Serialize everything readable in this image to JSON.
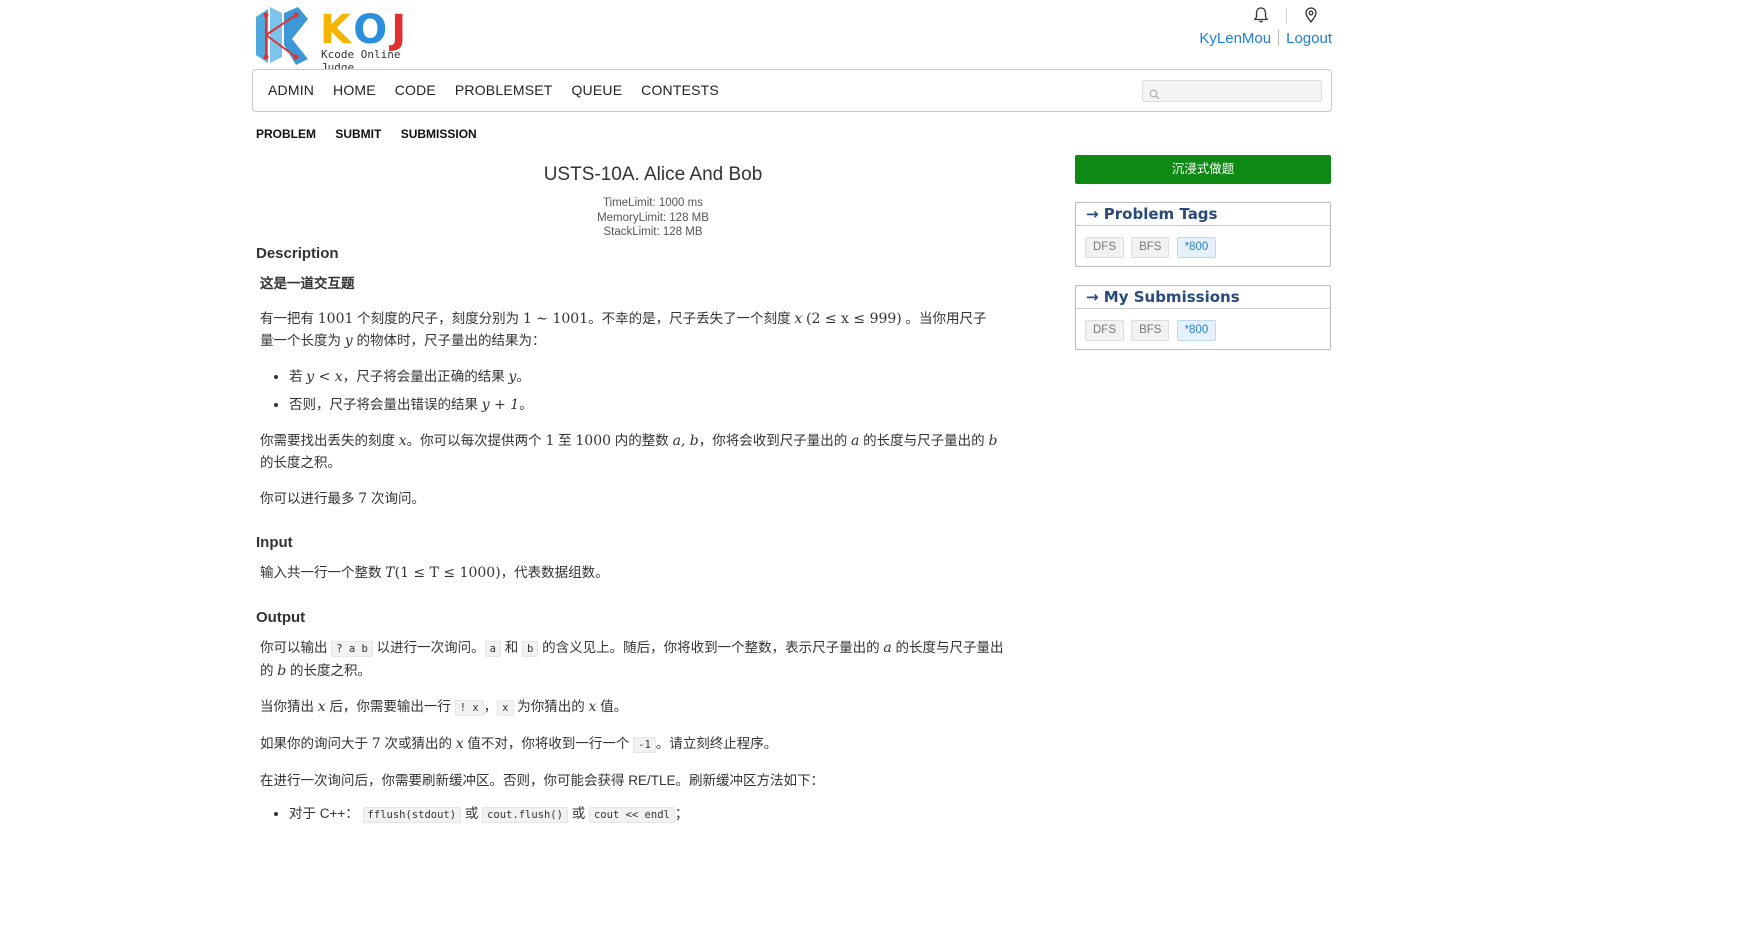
{
  "header": {
    "logo_text": "KOJ",
    "logo_subtitle": "Kcode Online Judge",
    "username": "KyLenMou",
    "logout": "Logout"
  },
  "nav": {
    "items": [
      "ADMIN",
      "HOME",
      "CODE",
      "PROBLEMSET",
      "QUEUE",
      "CONTESTS"
    ],
    "search_placeholder": ""
  },
  "subnav": {
    "items": [
      "PROBLEM",
      "SUBMIT",
      "SUBMISSION"
    ]
  },
  "problem": {
    "title": "USTS-10A. Alice And Bob",
    "time_limit": "TimeLimit: 1000 ms",
    "memory_limit": "MemoryLimit: 128 MB",
    "stack_limit": "StackLimit: 128 MB",
    "description_head": "Description",
    "interactive_note": "这是一道交互题",
    "desc_p1_a": "有一把有",
    "desc_p1_n1": "1001",
    "desc_p1_b": "个刻度的尺子，刻度分别为",
    "desc_p1_range": "1 ∼ 1001",
    "desc_p1_c": "。不幸的是，尺子丢失了一个刻度",
    "desc_p1_x": "x",
    "desc_p1_cond": "(2 ≤ x ≤ 999)",
    "desc_p1_d": "。当你用尺子",
    "desc_p1_e": "量一个长度为",
    "desc_p1_y": "y",
    "desc_p1_f": "的物体时，尺子量出的结果为：",
    "bullet1_a": "若",
    "bullet1_m": "y < x",
    "bullet1_b": "，尺子将会量出正确的结果",
    "bullet1_y": "y",
    "bullet1_c": "。",
    "bullet2_a": "否则，尺子将会量出错误的结果",
    "bullet2_m": "y + 1",
    "bullet2_c": "。",
    "desc_p2_a": "你需要找出丢失的刻度",
    "desc_p2_x": "x",
    "desc_p2_b": "。你可以每次提供两个",
    "desc_p2_n1": "1",
    "desc_p2_c": "至",
    "desc_p2_n2": "1000",
    "desc_p2_d": "内的整数",
    "desc_p2_ab": "a, b",
    "desc_p2_e": "，你将会收到尺子量出的",
    "desc_p2_a2": "a",
    "desc_p2_f": "的长度与尺子量出的",
    "desc_p2_b2": "b",
    "desc_p2_g": "的长度之积。",
    "desc_p3_a": "你可以进行最多",
    "desc_p3_n": "7",
    "desc_p3_b": "次询问。",
    "input_head": "Input",
    "input_a": "输入共一行一个整数",
    "input_T": "T",
    "input_cond": "(1 ≤ T ≤ 1000)",
    "input_b": "，代表数据组数。",
    "output_head": "Output",
    "out_p1_a": "你可以输出",
    "out_p1_code1": "? a b",
    "out_p1_b": "以进行一次询问。",
    "out_p1_code2": "a",
    "out_p1_c": "和",
    "out_p1_code3": "b",
    "out_p1_d": "的含义见上。随后，你将收到一个整数，表示尺子量出的",
    "out_p1_a2": "a",
    "out_p1_e": "的长度与尺子量出",
    "out_p1_f": "的",
    "out_p1_b2": "b",
    "out_p1_g": "的长度之积。",
    "out_p2_a": "当你猜出",
    "out_p2_x": "x",
    "out_p2_b": "后，你需要输出一行",
    "out_p2_code1": "! x",
    "out_p2_c": "，",
    "out_p2_code2": "x",
    "out_p2_d": "为你猜出的",
    "out_p2_x2": "x",
    "out_p2_e": "值。",
    "out_p3_a": "如果你的询问大于",
    "out_p3_n": "7",
    "out_p3_b": "次或猜出的",
    "out_p3_x": "x",
    "out_p3_c": "值不对，你将收到一行一个",
    "out_p3_code": "-1",
    "out_p3_d": "。请立刻终止程序。",
    "out_p4": "在进行一次询问后，你需要刷新缓冲区。否则，你可能会获得 RE/TLE。刷新缓冲区方法如下：",
    "flush_a": "对于 C++：",
    "flush_code1": "fflush(stdout)",
    "flush_or1": "或",
    "flush_code2": "cout.flush()",
    "flush_or2": "或",
    "flush_code3": "cout << endl",
    "flush_end": "；"
  },
  "sidebar": {
    "immersive_button": "沉浸式做题",
    "tags_title": "→ Problem Tags",
    "tags": [
      "DFS",
      "BFS",
      "*800"
    ],
    "submissions_title": "→ My Submissions",
    "submissions": [
      "DFS",
      "BFS",
      "*800"
    ]
  },
  "colors": {
    "link": "#1b7fd6",
    "button_green": "#0d8a13",
    "panel_title": "#2a4a7a"
  }
}
